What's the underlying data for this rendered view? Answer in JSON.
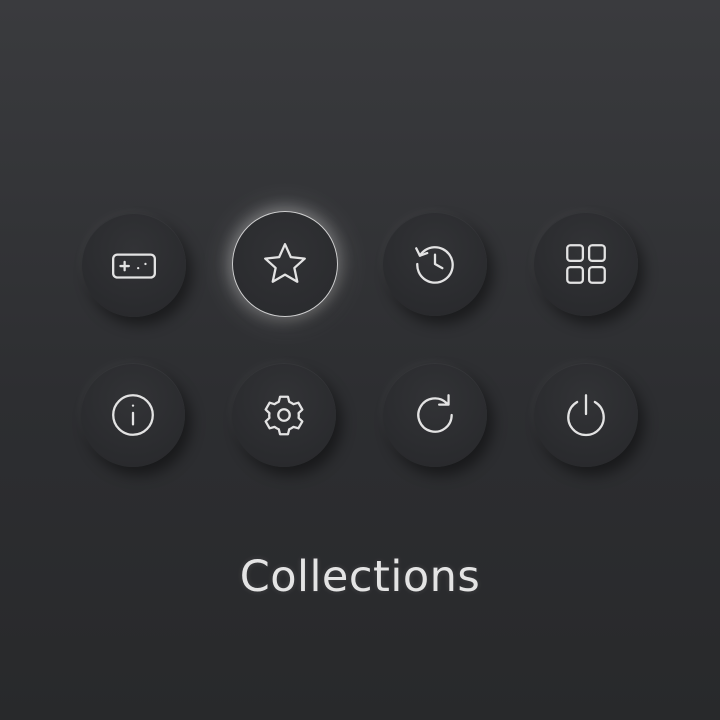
{
  "menu": {
    "items": [
      {
        "name": "games",
        "icon": "gamepad-icon"
      },
      {
        "name": "favorites",
        "icon": "star-icon",
        "selected": true
      },
      {
        "name": "history",
        "icon": "history-icon"
      },
      {
        "name": "all-apps",
        "icon": "grid-icon"
      },
      {
        "name": "info",
        "icon": "info-icon"
      },
      {
        "name": "settings",
        "icon": "gear-icon"
      },
      {
        "name": "refresh",
        "icon": "refresh-icon"
      },
      {
        "name": "power",
        "icon": "power-icon"
      }
    ],
    "selected_label": "Collections"
  },
  "colors": {
    "icon_stroke": "#e3e3e3",
    "background_top": "#3a3b3e",
    "background_bottom": "#28292b",
    "selection_glow": "#ffffff"
  }
}
